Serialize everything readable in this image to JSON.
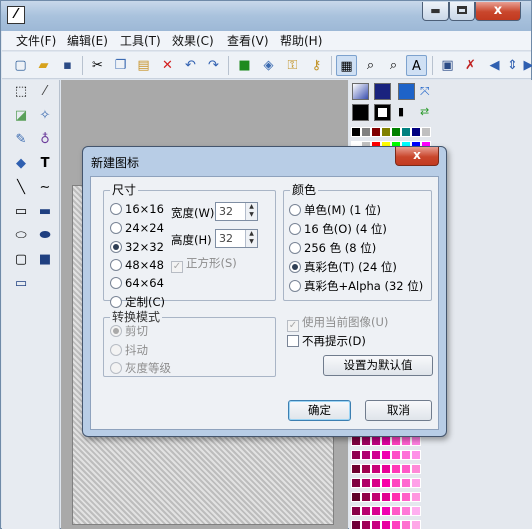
{
  "menu": [
    "文件(F)",
    "编辑(E)",
    "工具(T)",
    "效果(C)",
    "查看(V)",
    "帮助(H)"
  ],
  "dialog": {
    "title": "新建图标",
    "close_glyph": "x",
    "size": {
      "legend": "尺寸",
      "options": [
        "16×16",
        "24×24",
        "32×32",
        "48×48",
        "64×64",
        "定制(C)"
      ],
      "selected_index": 2,
      "width_label": "宽度(W)",
      "width_value": "32",
      "height_label": "高度(H)",
      "height_value": "32",
      "square_label": "正方形(S)",
      "square_checked": true
    },
    "color": {
      "legend": "颜色",
      "options": [
        "单色(M) (1 位)",
        "16 色(O) (4 位)",
        "256 色 (8 位)",
        "真彩色(T) (24 位)",
        "真彩色+Alpha (32 位)"
      ],
      "selected_index": 3
    },
    "convert": {
      "legend": "转换模式",
      "options": [
        "剪切",
        "抖动",
        "灰度等级"
      ],
      "selected_index": 0
    },
    "use_current_label": "使用当前图像(U)",
    "use_current_checked": true,
    "no_prompt_label": "不再提示(D)",
    "no_prompt_checked": false,
    "set_default_label": "设置为默认值",
    "ok_label": "确定",
    "cancel_label": "取消"
  },
  "window_controls": {
    "minimize": "▬",
    "close": "x"
  },
  "colors": {
    "accent": "#3c7fb1",
    "close_red": "#c9462c",
    "workspace": "#a9a9a9"
  }
}
